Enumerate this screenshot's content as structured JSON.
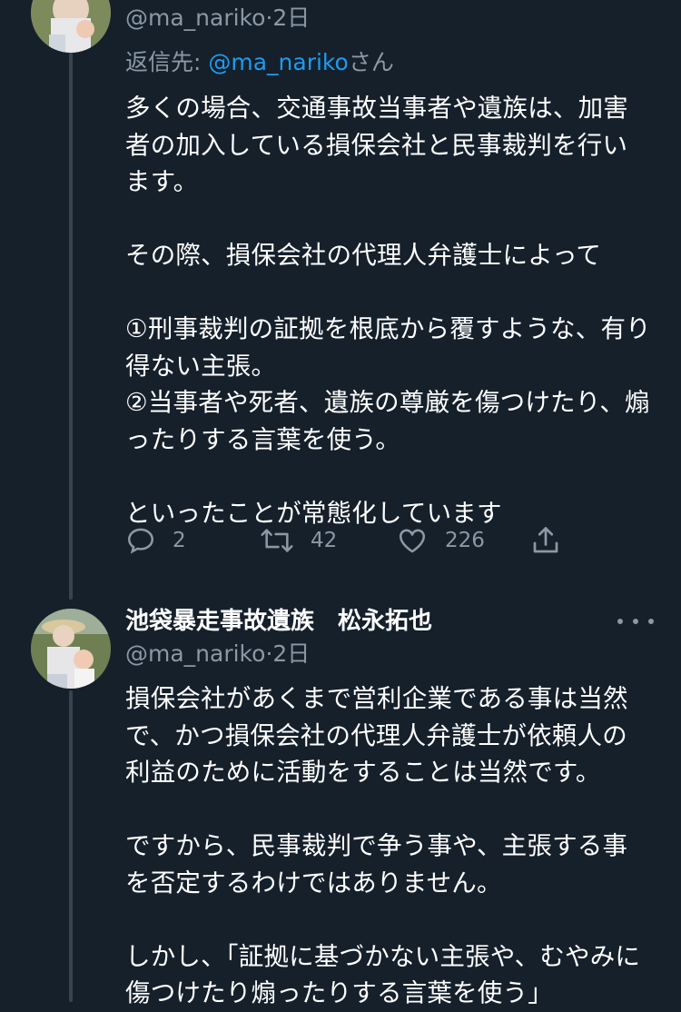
{
  "tweets": [
    {
      "handle": "@ma_nariko",
      "separator": "·",
      "time": "2日",
      "reply_prefix": "返信先: ",
      "reply_mention": "@ma_nariko",
      "reply_suffix": "さん",
      "text": "多くの場合、交通事故当事者や遺族は、加害者の加入している損保会社と民事裁判を行います。\n\nその際、損保会社の代理人弁護士によって\n\n①刑事裁判の証拠を根底から覆すような、有り得ない主張。\n②当事者や死者、遺族の尊厳を傷つけたり、煽ったりする言葉を使う。\n\nといったことが常態化しています",
      "actions": {
        "reply_count": "2",
        "retweet_count": "42",
        "like_count": "226"
      }
    },
    {
      "display_name": "池袋暴走事故遺族　松永拓也",
      "handle": "@ma_nariko",
      "separator": "·",
      "time": "2日",
      "text": "損保会社があくまで営利企業である事は当然で、かつ損保会社の代理人弁護士が依頼人の利益のために活動をすることは当然です。\n\nですから、民事裁判で争う事や、主張する事を否定するわけではありません。\n\nしかし、「証拠に基づかない主張や、むやみに傷つけたり煽ったりする言葉を使う」"
    }
  ],
  "icons": {
    "reply": "reply-icon",
    "retweet": "retweet-icon",
    "like": "like-icon",
    "share": "share-icon",
    "more": "more-icon"
  },
  "colors": {
    "background": "#15202b",
    "text": "#ffffff",
    "secondary": "#8b98a5",
    "link": "#1d9bf0",
    "thread_line": "#38444d"
  }
}
